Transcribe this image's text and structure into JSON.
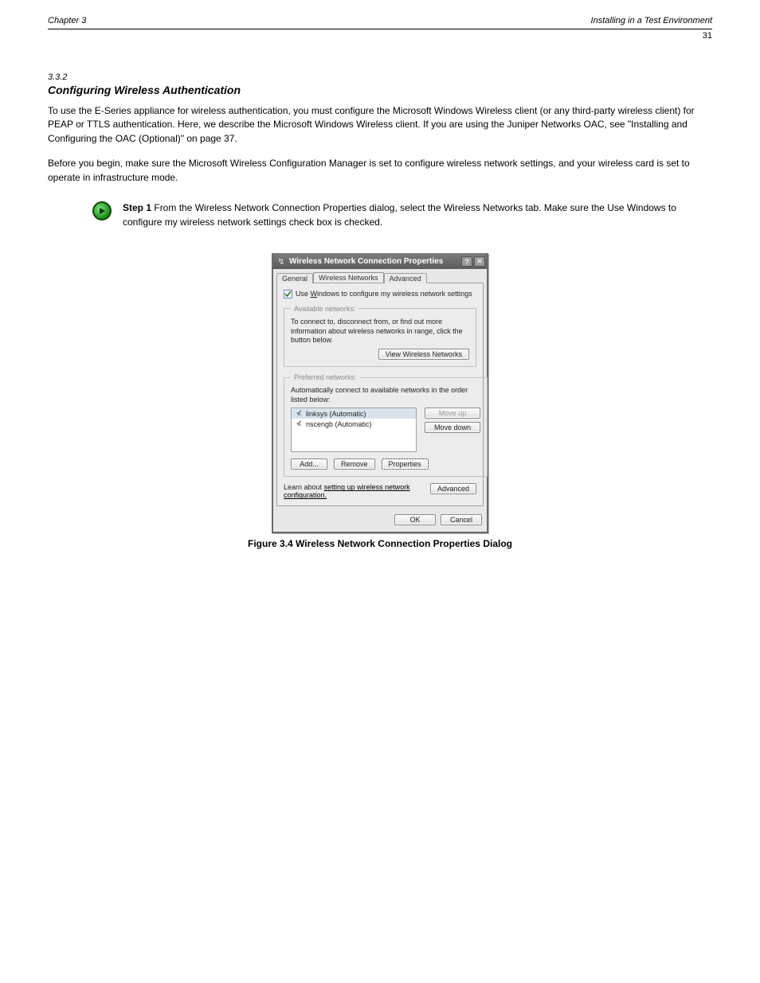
{
  "header": {
    "left": "Chapter 3",
    "right": "Installing in a Test Environment",
    "pagenum": "31"
  },
  "section": {
    "number": "3.3.2",
    "title": "Configuring Wireless Authentication"
  },
  "paragraphs": {
    "p1": "To use the E-Series appliance for wireless authentication, you must configure the Microsoft Windows Wireless client (or any third-party wireless client) for PEAP or TTLS authentication. Here, we describe the Microsoft Windows Wireless client. If you are using the Juniper Networks OAC, see \"Installing and Configuring the OAC (Optional)\" on page 37.",
    "p2": "Before you begin, make sure the Microsoft Wireless Configuration Manager is set to configure wireless network settings, and your wireless card is set to operate in infrastructure mode."
  },
  "step": {
    "label": "Step 1 ",
    "text": "From the Wireless Network Connection Properties dialog, select the Wireless Networks tab. Make sure the Use Windows to configure my wireless network settings check box is checked."
  },
  "dialog": {
    "title": "Wireless Network Connection Properties",
    "tabs": {
      "general": "General",
      "wireless": "Wireless Networks",
      "advanced": "Advanced"
    },
    "checkbox_pre": "Use ",
    "checkbox_w": "W",
    "checkbox_post": "indows to configure my wireless network settings",
    "available": {
      "legend": "Available networks:",
      "text": "To connect to, disconnect from, or find out more information about wireless networks in range, click the button below.",
      "view_btn": "View Wireless Networks"
    },
    "preferred": {
      "legend": "Preferred networks:",
      "text": "Automatically connect to available networks in the order listed below:",
      "items": [
        {
          "label": "linksys (Automatic)"
        },
        {
          "label": "nscengb (Automatic)"
        }
      ],
      "move_up": "Move up",
      "move_down": "Move down",
      "add": "Add...",
      "remove": "Remove",
      "properties": "Properties"
    },
    "learn": {
      "pre": "Learn about ",
      "link": "setting up wireless network configuration.",
      "advanced": "Advanced"
    },
    "buttons": {
      "ok": "OK",
      "cancel": "Cancel"
    }
  },
  "figure_caption": "Figure 3.4 Wireless Network Connection Properties Dialog"
}
